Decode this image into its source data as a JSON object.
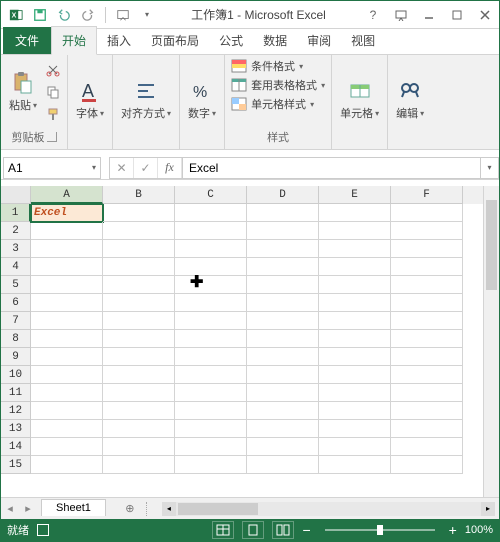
{
  "title": "工作簿1 - Microsoft Excel",
  "tabs": {
    "file": "文件",
    "home": "开始",
    "insert": "插入",
    "layout": "页面布局",
    "formulas": "公式",
    "data": "数据",
    "review": "审阅",
    "view": "视图"
  },
  "ribbon": {
    "clipboard": {
      "paste": "粘贴",
      "label": "剪贴板"
    },
    "font": {
      "label": "字体"
    },
    "align": {
      "label": "对齐方式"
    },
    "number": {
      "label": "数字"
    },
    "styles": {
      "cond": "条件格式",
      "table": "套用表格格式",
      "cell": "单元格样式",
      "label": "样式"
    },
    "cells": {
      "label": "单元格"
    },
    "editing": {
      "label": "编辑"
    }
  },
  "namebox": "A1",
  "formula": "Excel",
  "columns": [
    "A",
    "B",
    "C",
    "D",
    "E",
    "F"
  ],
  "rows": [
    "1",
    "2",
    "3",
    "4",
    "5",
    "6",
    "7",
    "8",
    "9",
    "10",
    "11",
    "12",
    "13",
    "14",
    "15"
  ],
  "cellA1": "Excel",
  "sheet": "Sheet1",
  "status": {
    "ready": "就绪",
    "zoom": "100%"
  }
}
